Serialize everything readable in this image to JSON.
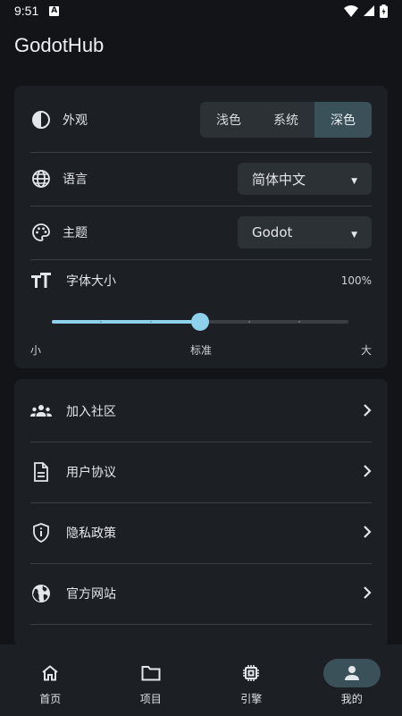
{
  "status": {
    "time": "9:51",
    "notif_glyph": "A"
  },
  "app": {
    "title": "GodotHub"
  },
  "appearance": {
    "label": "外观",
    "options": [
      "浅色",
      "系统",
      "深色"
    ],
    "selected": "深色"
  },
  "language": {
    "label": "语言",
    "value": "简体中文"
  },
  "theme": {
    "label": "主题",
    "value": "Godot"
  },
  "font_size": {
    "label": "字体大小",
    "value_text": "100%",
    "slider_steps": 7,
    "slider_index": 3,
    "min_label": "小",
    "mid_label": "标准",
    "max_label": "大"
  },
  "links": [
    {
      "label": "加入社区",
      "icon": "community-icon"
    },
    {
      "label": "用户协议",
      "icon": "document-icon"
    },
    {
      "label": "隐私政策",
      "icon": "shield-icon"
    },
    {
      "label": "官方网站",
      "icon": "globe-icon"
    }
  ],
  "nav": [
    {
      "label": "首页",
      "icon": "home-icon"
    },
    {
      "label": "项目",
      "icon": "folder-icon"
    },
    {
      "label": "引擎",
      "icon": "chip-icon"
    },
    {
      "label": "我的",
      "icon": "person-icon",
      "active": true
    }
  ],
  "colors": {
    "accent": "#8fd0ec",
    "surface": "#1c2024",
    "background": "#121417",
    "selected": "#3b5159"
  }
}
